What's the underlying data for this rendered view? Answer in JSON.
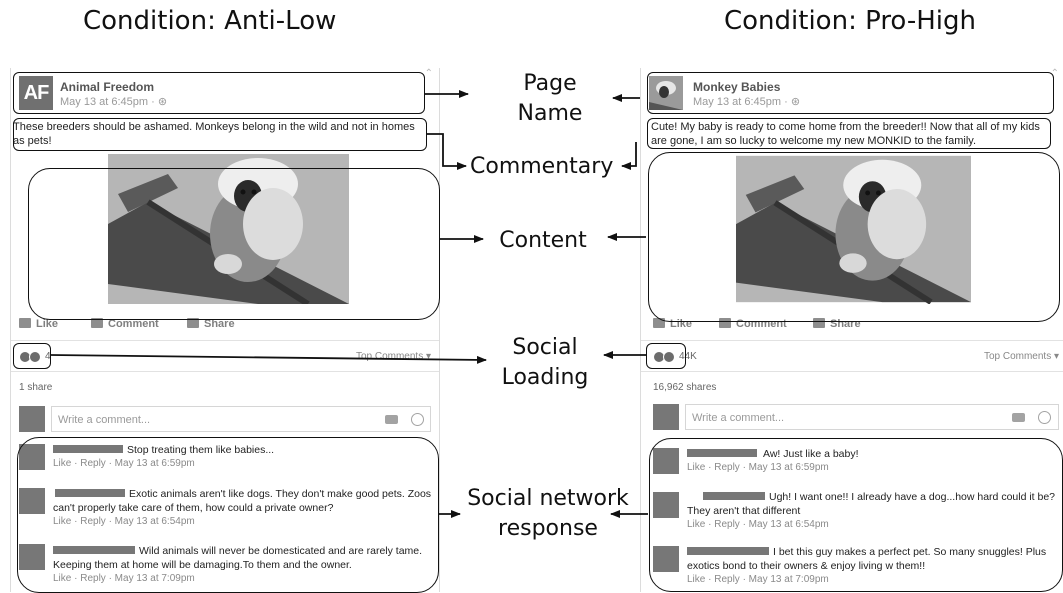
{
  "titles": {
    "left": "Condition: Anti-Low",
    "right": "Condition: Pro-High"
  },
  "labels": {
    "page_name_1": "Page",
    "page_name_2": "Name",
    "commentary": "Commentary",
    "content": "Content",
    "social_loading_1": "Social",
    "social_loading_2": "Loading",
    "social_network_1": "Social network",
    "social_network_2": "response"
  },
  "left_post": {
    "avatar_text": "AF",
    "page_name": "Animal Freedom",
    "date": "May 13 at 6:45pm · ",
    "commentary": "These breeders should be ashamed. Monkeys belong in the wild and not in homes as pets!",
    "actions": {
      "like": "Like",
      "comment": "Comment",
      "share": "Share"
    },
    "reaction_count": "4",
    "top_comments": "Top Comments ▾",
    "shares": "1 share",
    "write_placeholder": "Write a comment...",
    "comments": [
      {
        "text": "Stop treating them like babies...",
        "meta": "Like · Reply · May 13 at 6:59pm"
      },
      {
        "text": "Exotic animals aren't like dogs. They don't make good pets. Zoos can't properly take care of them, how could a private owner?",
        "meta": "Like · Reply · May 13 at 6:54pm"
      },
      {
        "text": "Wild animals will never be domesticated and are rarely tame. Keeping them at home will be damaging.To them and the owner.",
        "meta": "Like · Reply · May 13 at 7:09pm"
      }
    ]
  },
  "right_post": {
    "page_name": "Monkey Babies",
    "date": "May 13 at 6:45pm · ",
    "commentary": "Cute! My baby is ready to come home from the breeder!! Now that all of my kids are gone, I am so lucky to welcome my new MONKID to the family.",
    "actions": {
      "like": "Like",
      "comment": "Comment",
      "share": "Share"
    },
    "reaction_count": "44K",
    "top_comments": "Top Comments ▾",
    "shares": "16,962 shares",
    "write_placeholder": "Write a comment...",
    "comments": [
      {
        "text": "Aw! Just like a baby!",
        "meta": "Like · Reply · May 13 at 6:59pm"
      },
      {
        "text": "Ugh! I want one!! I already have a dog...how hard could it be? They aren't that different",
        "meta": "Like · Reply · May 13 at 6:54pm"
      },
      {
        "text": "I bet this guy makes a perfect pet. So many snuggles! Plus exotics bond to their owners & enjoy living w them!!",
        "meta": "Like · Reply · May 13 at 7:09pm"
      }
    ]
  },
  "icons": [
    "globe-icon",
    "like-icon",
    "comment-icon",
    "share-icon",
    "reaction-icon",
    "camera-icon",
    "smiley-icon",
    "monkey-photo",
    "collapse-chevron-icon"
  ]
}
